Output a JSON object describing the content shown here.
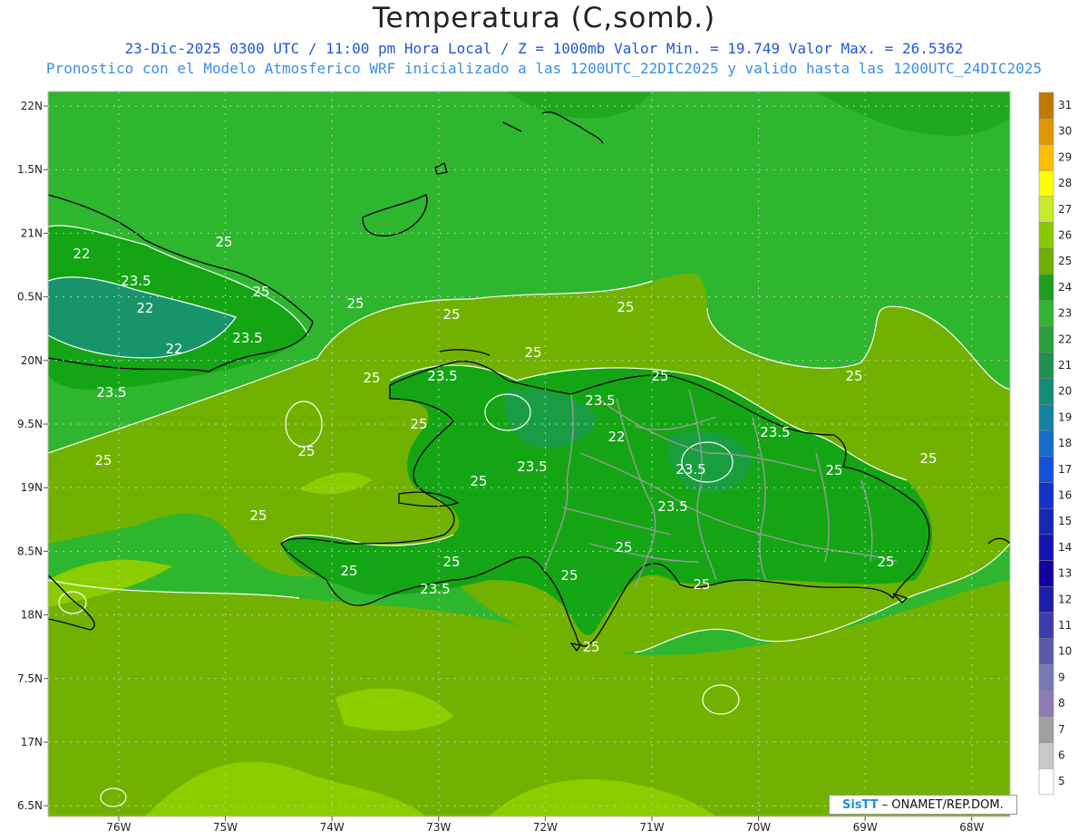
{
  "header": {
    "title": "Temperatura (C,somb.)",
    "subtitle_line1": "23-Dic-2025 0300 UTC / 11:00 pm Hora Local / Z = 1000mb   Valor Min. = 19.749  Valor Max. = 26.5362",
    "subtitle_line2": "Pronostico con el Modelo Atmosferico WRF inicializado a las 1200UTC_22DIC2025 y valido hasta las  1200UTC_24DIC2025"
  },
  "map": {
    "lat_labels": [
      "22N",
      "1.5N",
      "21N",
      "0.5N",
      "20N",
      "9.5N",
      "19N",
      "8.5N",
      "18N",
      "7.5N",
      "17N",
      "6.5N"
    ],
    "lon_labels": [
      "76W",
      "75W",
      "74W",
      "73W",
      "72W",
      "71W",
      "70W",
      "69W",
      "68W"
    ],
    "contour_labels": [
      {
        "text": "22"
      },
      {
        "text": "23.5"
      },
      {
        "text": "22"
      },
      {
        "text": "22"
      },
      {
        "text": "23.5"
      },
      {
        "text": "23.5"
      },
      {
        "text": "25"
      },
      {
        "text": "25"
      },
      {
        "text": "25"
      },
      {
        "text": "25"
      },
      {
        "text": "25"
      },
      {
        "text": "25"
      },
      {
        "text": "25"
      },
      {
        "text": "25"
      },
      {
        "text": "25"
      },
      {
        "text": "23.5"
      },
      {
        "text": "23.5"
      },
      {
        "text": "22"
      },
      {
        "text": "23.5"
      },
      {
        "text": "23.5"
      },
      {
        "text": "23.5"
      },
      {
        "text": "23.5"
      },
      {
        "text": "25"
      },
      {
        "text": "25"
      },
      {
        "text": "25"
      },
      {
        "text": "25"
      },
      {
        "text": "25"
      },
      {
        "text": "25"
      },
      {
        "text": "25"
      },
      {
        "text": "25"
      },
      {
        "text": "25"
      },
      {
        "text": "23.5"
      },
      {
        "text": "25"
      },
      {
        "text": "25"
      },
      {
        "text": "25"
      },
      {
        "text": "25"
      },
      {
        "text": "25"
      }
    ],
    "colors": {
      "green_dark": "#14a514",
      "green_mid": "#2eb62e",
      "yellow_green": "#71b200",
      "light_green": "#8ccd00",
      "teal": "#18907a",
      "coast": "#000000",
      "border": "#9a9a9a"
    }
  },
  "colorbar": {
    "labels": [
      "31",
      "30",
      "29",
      "28",
      "27",
      "26",
      "25",
      "24",
      "23",
      "22",
      "21",
      "20",
      "19",
      "18",
      "17",
      "16",
      "15",
      "14",
      "13",
      "12",
      "11",
      "10",
      "9",
      "8",
      "7",
      "6",
      "5"
    ],
    "colors": [
      "#c07800",
      "#e09600",
      "#ffbe00",
      "#ffff00",
      "#c8eb2c",
      "#8cc800",
      "#6eaf00",
      "#1ea01e",
      "#32b432",
      "#28a03c",
      "#1e9050",
      "#148c78",
      "#1482a0",
      "#146ec8",
      "#1450dc",
      "#1432c8",
      "#1428b4",
      "#1414b4",
      "#1400a0",
      "#1e1eaa",
      "#3c3caa",
      "#5a5aaa",
      "#7878b4",
      "#8c7cb4",
      "#a0a0a0",
      "#c8c8c8",
      "#ffffff"
    ]
  },
  "credit": {
    "logo": "SisTT",
    "text": " – ONAMET/REP.DOM."
  }
}
